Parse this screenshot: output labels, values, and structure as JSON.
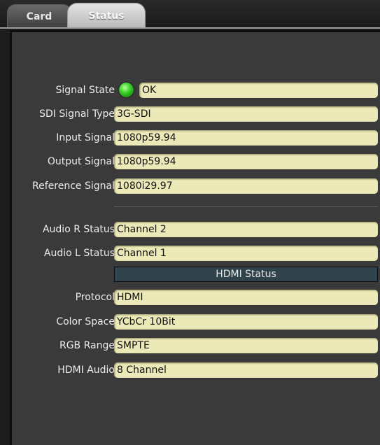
{
  "tabs": [
    {
      "label": "Card"
    },
    {
      "label": "Status"
    }
  ],
  "status": {
    "signal_state": {
      "label": "Signal State",
      "value": "OK",
      "indicator_color": "#3bd12a"
    },
    "sdi_signal_type": {
      "label": "SDI Signal Type",
      "value": "3G-SDI"
    },
    "input_signal": {
      "label": "Input Signal",
      "value": "1080p59.94"
    },
    "output_signal": {
      "label": "Output Signal",
      "value": "1080p59.94"
    },
    "reference_signal": {
      "label": "Reference Signal",
      "value": "1080i29.97"
    },
    "audio_r_status": {
      "label": "Audio R Status",
      "value": "Channel 2"
    },
    "audio_l_status": {
      "label": "Audio L Status",
      "value": "Channel 1"
    },
    "hdmi_header": "HDMI Status",
    "protocol": {
      "label": "Protocol",
      "value": "HDMI"
    },
    "color_space": {
      "label": "Color Space",
      "value": "YCbCr 10Bit"
    },
    "rgb_range": {
      "label": "RGB Range",
      "value": "SMPTE"
    },
    "hdmi_audio": {
      "label": "HDMI Audio",
      "value": "8 Channel"
    }
  }
}
